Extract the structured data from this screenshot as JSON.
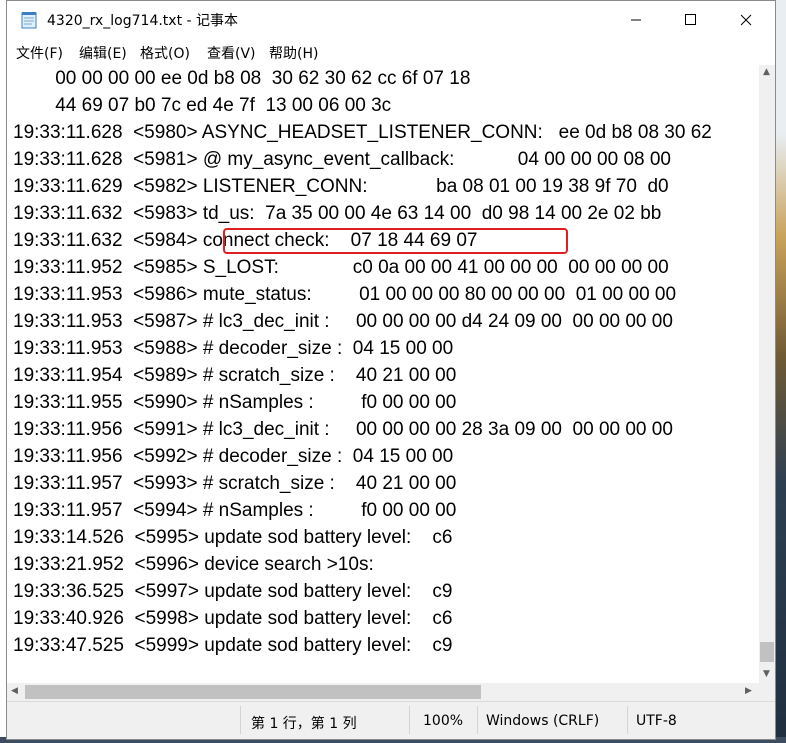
{
  "window": {
    "title": "4320_rx_log714.txt - 记事本",
    "icon": "notepad-icon",
    "controls": [
      "minimize-icon",
      "maximize-icon",
      "close-icon"
    ]
  },
  "menu": [
    {
      "label": "文件(F)"
    },
    {
      "label": "编辑(E)"
    },
    {
      "label": "格式(O)"
    },
    {
      "label": "查看(V)"
    },
    {
      "label": "帮助(H)"
    }
  ],
  "lines": [
    "        00 00 00 00 ee 0d b8 08  30 62 30 62 cc 6f 07 18",
    "        44 69 07 b0 7c ed 4e 7f  13 00 06 00 3c",
    "19:33:11.628  <5980> ASYNC_HEADSET_LISTENER_CONN:   ee 0d b8 08 30 62",
    "19:33:11.628  <5981> @ my_async_event_callback:            04 00 00 00 08 00",
    "19:33:11.629  <5982> LISTENER_CONN:             ba 08 01 00 19 38 9f 70  d0",
    "19:33:11.632  <5983> td_us:  7a 35 00 00 4e 63 14 00  d0 98 14 00 2e 02 bb",
    "19:33:11.632  <5984> connect check:    07 18 44 69 07",
    "19:33:11.952  <5985> S_LOST:              c0 0a 00 00 41 00 00 00  00 00 00 00",
    "19:33:11.953  <5986> mute_status:         01 00 00 00 80 00 00 00  01 00 00 00",
    "19:33:11.953  <5987> # lc3_dec_init :     00 00 00 00 d4 24 09 00  00 00 00 00",
    "19:33:11.953  <5988> # decoder_size :  04 15 00 00",
    "19:33:11.954  <5989> # scratch_size :    40 21 00 00",
    "19:33:11.955  <5990> # nSamples :         f0 00 00 00",
    "19:33:11.956  <5991> # lc3_dec_init :     00 00 00 00 28 3a 09 00  00 00 00 00",
    "19:33:11.956  <5992> # decoder_size :  04 15 00 00",
    "19:33:11.957  <5993> # scratch_size :    40 21 00 00",
    "19:33:11.957  <5994> # nSamples :         f0 00 00 00",
    "19:33:14.526  <5995> update sod battery level:    c6",
    "19:33:21.952  <5996> device search >10s:",
    "19:33:36.525  <5997> update sod battery level:    c9",
    "19:33:40.926  <5998> update sod battery level:    c6",
    "19:33:47.525  <5999> update sod battery level:    c9"
  ],
  "highlight_color": "#e02020",
  "status": {
    "position": "第 1 行，第 1 列",
    "zoom": "100%",
    "line_ending": "Windows (CRLF)",
    "encoding": "UTF-8"
  },
  "scrollbars": {
    "vertical_icons": [
      "scroll-up-icon",
      "scroll-down-icon"
    ],
    "horizontal_icons": [
      "scroll-left-icon",
      "scroll-right-icon"
    ]
  }
}
